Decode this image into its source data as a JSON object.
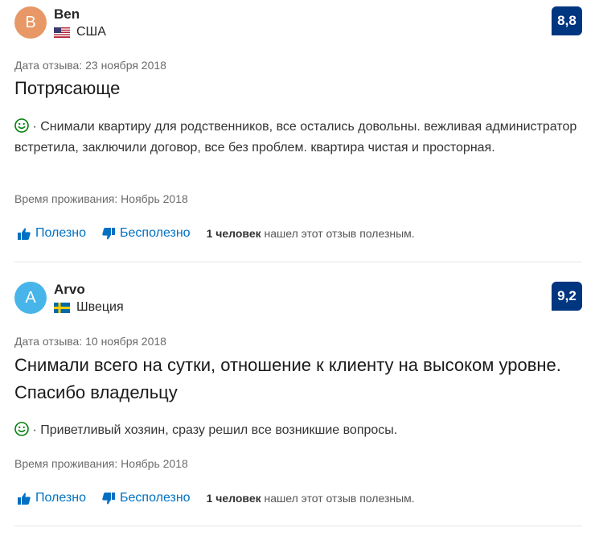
{
  "colors": {
    "accent": "#0071c2",
    "score_bg": "#003580",
    "smile": "#008009"
  },
  "reviews": [
    {
      "avatar_letter": "B",
      "avatar_color": "#e89766",
      "name": "Ben",
      "country": "США",
      "flag": "usa-flag-icon",
      "score": "8,8",
      "date": "Дата отзыва: 23 ноября 2018",
      "title": "Потрясающе",
      "positive_text": "Снимали квартиру для родственников, все остались довольны. вежливая администратор встретила, заключили договор, все без проблем. квартира чистая и просторная.",
      "stay": "Время проживания: Ноябрь 2018",
      "helpful_label": "Полезно",
      "not_helpful_label": "Бесполезно",
      "helpful_count": "1 человек",
      "helpful_suffix": "нашел этот отзыв полезным."
    },
    {
      "avatar_letter": "A",
      "avatar_color": "#47b5e9",
      "name": "Arvo",
      "country": "Швеция",
      "flag": "sweden-flag-icon",
      "score": "9,2",
      "date": "Дата отзыва: 10 ноября 2018",
      "title": "Снимали всего на сутки, отношение к клиенту на высоком уровне. Спасибо владельцу",
      "positive_text": "Приветливый хозяин, сразу решил все возникшие вопросы.",
      "stay": "Время проживания: Ноябрь 2018",
      "helpful_label": "Полезно",
      "not_helpful_label": "Бесполезно",
      "helpful_count": "1 человек",
      "helpful_suffix": "нашел этот отзыв полезным."
    }
  ]
}
